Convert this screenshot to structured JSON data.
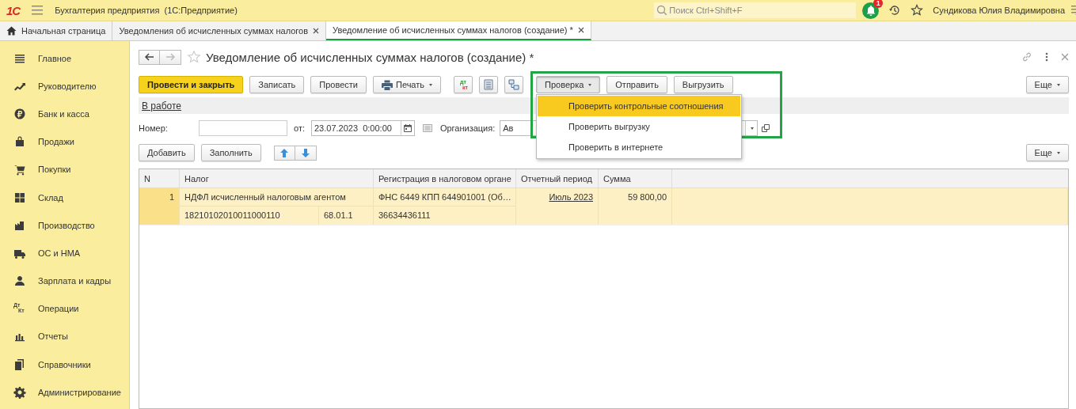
{
  "app": {
    "logo": "1С",
    "title": "Бухгалтерия предприятия  (1С:Предприятие)",
    "search": {
      "placeholder": "Поиск Ctrl+Shift+F"
    },
    "notifications": "1",
    "user": "Сундикова Юлия Владимировна"
  },
  "tabs": [
    {
      "label": "Начальная страница",
      "kind": "home",
      "selected": false
    },
    {
      "label": "Уведомления об исчисленных суммах налогов",
      "kind": "doc",
      "selected": false
    },
    {
      "label": "Уведомление об исчисленных суммах налогов (создание) *",
      "kind": "doc",
      "selected": true
    }
  ],
  "sidebar": {
    "items": [
      {
        "label": "Главное"
      },
      {
        "label": "Руководителю"
      },
      {
        "label": "Банк и касса"
      },
      {
        "label": "Продажи"
      },
      {
        "label": "Покупки"
      },
      {
        "label": "Склад"
      },
      {
        "label": "Производство"
      },
      {
        "label": "ОС и НМА"
      },
      {
        "label": "Зарплата и кадры"
      },
      {
        "label": "Операции",
        "icon_text": [
          "Дт",
          "Кт"
        ]
      },
      {
        "label": "Отчеты"
      },
      {
        "label": "Справочники"
      },
      {
        "label": "Администрирование"
      }
    ]
  },
  "form": {
    "title": "Уведомление об исчисленных суммах налогов (создание) *",
    "toolbar": {
      "main_buttons": [
        {
          "label": "Провести и закрыть",
          "kind": "primary",
          "has_menu": false
        },
        {
          "label": "Записать",
          "kind": "plain",
          "has_menu": false
        },
        {
          "label": "Провести",
          "kind": "plain",
          "has_menu": false
        },
        {
          "label": "Печать",
          "kind": "print",
          "has_menu": true
        }
      ],
      "dtkt_icon": [
        "дт",
        "кт"
      ],
      "check_buttons": [
        {
          "label": "Проверка",
          "pressed": true,
          "has_menu": true
        },
        {
          "label": "Отправить",
          "pressed": false,
          "has_menu": false
        },
        {
          "label": "Выгрузить",
          "pressed": false,
          "has_menu": false
        }
      ],
      "check_menu": [
        {
          "label": "Проверить контрольные соотношения",
          "selected": true
        },
        {
          "label": "Проверить выгрузку",
          "selected": false
        },
        {
          "label": "Проверить в интернете",
          "selected": false
        }
      ],
      "more": "Еще"
    },
    "status_link": "В работе",
    "fields": {
      "number_label": "Номер:",
      "date_label": "от:",
      "date_value": "23.07.2023  0:00:00",
      "org_label": "Организация:",
      "org_value": "Ав"
    },
    "table_toolbar": {
      "buttons": [
        "Добавить",
        "Заполнить"
      ],
      "more": "Еще"
    },
    "table": {
      "columns": [
        "N",
        "Налог",
        "Регистрация в налоговом органе",
        "Отчетный период",
        "Сумма"
      ],
      "rows": [
        {
          "n": "1",
          "tax": "НДФЛ исчисленный налоговым агентом",
          "kbk": "18210102010011000110",
          "account": "68.01.1",
          "registration": "ФНС 6449 КПП 644901001 (Об…",
          "oktmo": "36634436111",
          "period": "Июль 2023",
          "sum": "59 800,00",
          "selected": true
        }
      ]
    }
  }
}
